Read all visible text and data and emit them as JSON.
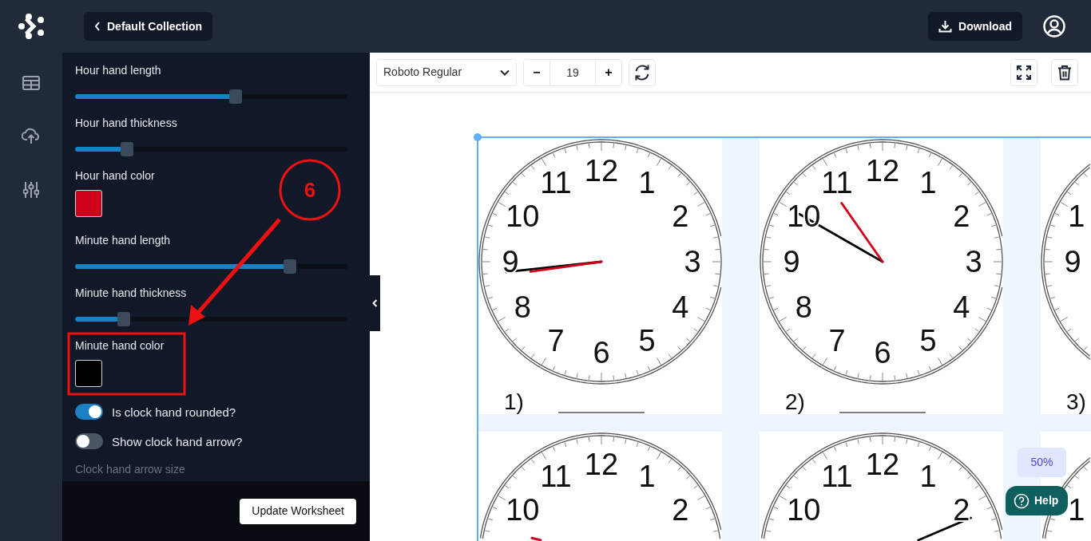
{
  "top_bar": {
    "back_button": "Default Collection",
    "download_button": "Download"
  },
  "settings": [
    {
      "kind": "slider",
      "label": "Hour hand length",
      "level": 0.59,
      "disabled": false
    },
    {
      "kind": "slider",
      "label": "Hour hand thickness",
      "level": 0.19,
      "disabled": false
    },
    {
      "kind": "color",
      "label": "Hour hand color",
      "color": "#d0021b",
      "disabled": false
    },
    {
      "kind": "slider",
      "label": "Minute hand length",
      "level": 0.79,
      "disabled": false
    },
    {
      "kind": "slider",
      "label": "Minute hand thickness",
      "level": 0.18,
      "disabled": false
    },
    {
      "kind": "color",
      "label": "Minute hand color",
      "color": "#000000",
      "disabled": false
    },
    {
      "kind": "toggle",
      "label": "Is clock hand rounded?",
      "on": true,
      "disabled": false
    },
    {
      "kind": "toggle",
      "label": "Show clock hand arrow?",
      "on": false,
      "disabled": false
    },
    {
      "kind": "caption",
      "label": "Clock hand arrow size",
      "disabled": true
    }
  ],
  "update_button": "Update Worksheet",
  "annotation": {
    "step": "6"
  },
  "toolbar": {
    "font": "Roboto Regular",
    "decrement": "−",
    "font_size": "19",
    "increment": "+"
  },
  "zoom": "50%",
  "help_button": "Help",
  "worksheet": {
    "clocks": [
      {
        "label": "1)",
        "numerals": [
          "12",
          "11",
          "1",
          "10",
          "2",
          "9",
          "3",
          "8",
          "4",
          "7",
          "5",
          "6"
        ]
      },
      {
        "label": "2)",
        "numerals": [
          "12",
          "11",
          "1",
          "10",
          "2",
          "9",
          "3",
          "8",
          "4",
          "7",
          "5",
          "6"
        ]
      },
      {
        "label": "3)",
        "numerals": [
          "1",
          "9"
        ]
      },
      {
        "numerals": [
          "12",
          "11",
          "1",
          "10",
          "2"
        ]
      },
      {
        "numerals": [
          "12",
          "11",
          "1",
          "10",
          "2"
        ]
      },
      {
        "numerals": [
          "1"
        ]
      }
    ]
  }
}
